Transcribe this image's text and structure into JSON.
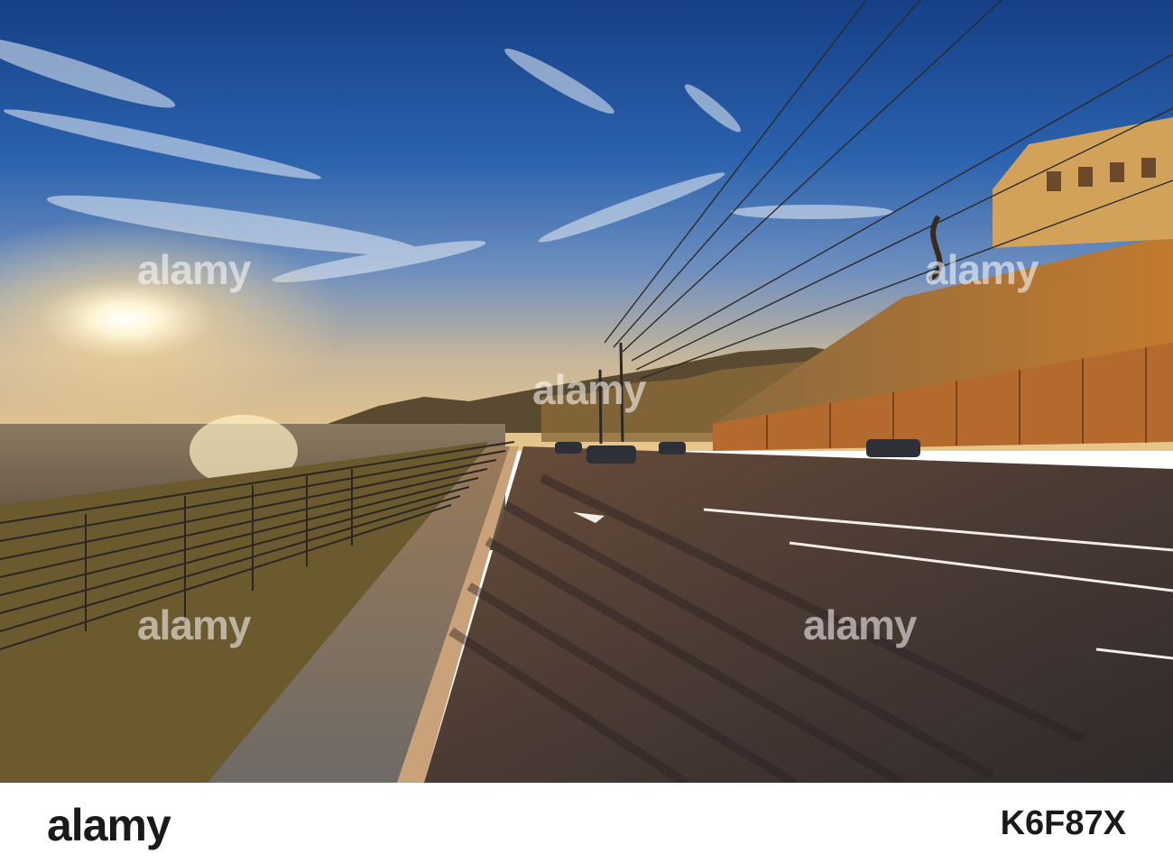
{
  "watermark": {
    "text": "alamy"
  },
  "footer": {
    "logo": "alamy",
    "image_id": "K6F87X"
  },
  "colors": {
    "sky_top": "#1b4a8f",
    "sun": "#fff4cc",
    "road": "#3b3230",
    "wall": "#b8672a"
  }
}
